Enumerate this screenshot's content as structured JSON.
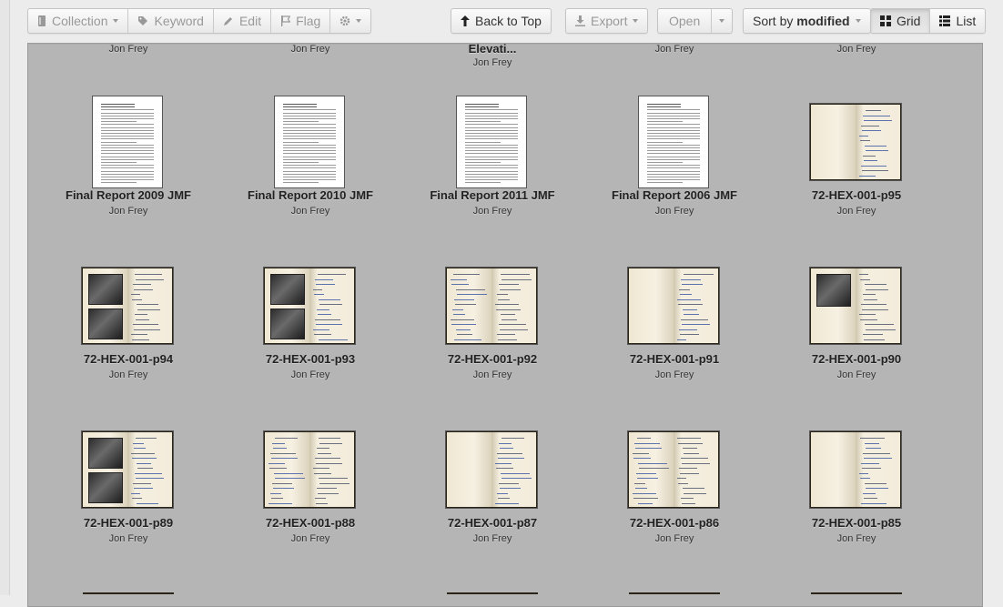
{
  "toolbar": {
    "collection": "Collection",
    "keyword": "Keyword",
    "edit": "Edit",
    "flag": "Flag",
    "back_to_top": "Back to Top",
    "export": "Export",
    "open": "Open",
    "sort_prefix": "Sort by",
    "sort_value": "modified",
    "grid": "Grid",
    "list": "List"
  },
  "top_row": [
    {
      "title": "",
      "author": "Jon Frey"
    },
    {
      "title": "",
      "author": "Jon Frey"
    },
    {
      "title": "Elevati...",
      "author": "Jon Frey"
    },
    {
      "title": "",
      "author": "Jon Frey"
    },
    {
      "title": "",
      "author": "Jon Frey"
    }
  ],
  "rows": [
    [
      {
        "kind": "doc",
        "title": "Final Report 2009 JMF",
        "author": "Jon Frey"
      },
      {
        "kind": "doc",
        "title": "Final Report 2010 JMF",
        "author": "Jon Frey"
      },
      {
        "kind": "doc",
        "title": "Final Report 2011 JMF",
        "author": "Jon Frey"
      },
      {
        "kind": "doc",
        "title": "Final Report 2006 JMF",
        "author": "Jon Frey"
      },
      {
        "kind": "book",
        "photos": 0,
        "title": "72-HEX-001-p95",
        "author": "Jon Frey"
      }
    ],
    [
      {
        "kind": "book",
        "photos": 2,
        "title": "72-HEX-001-p94",
        "author": "Jon Frey"
      },
      {
        "kind": "book",
        "photos": 2,
        "title": "72-HEX-001-p93",
        "author": "Jon Frey"
      },
      {
        "kind": "book",
        "photos": 0,
        "title": "72-HEX-001-p92",
        "author": "Jon Frey"
      },
      {
        "kind": "book",
        "photos": 0,
        "title": "72-HEX-001-p91",
        "author": "Jon Frey"
      },
      {
        "kind": "book",
        "photos": 1,
        "title": "72-HEX-001-p90",
        "author": "Jon Frey"
      }
    ],
    [
      {
        "kind": "book",
        "photos": 2,
        "title": "72-HEX-001-p89",
        "author": "Jon Frey"
      },
      {
        "kind": "book",
        "photos": 0,
        "title": "72-HEX-001-p88",
        "author": "Jon Frey"
      },
      {
        "kind": "book",
        "photos": 0,
        "title": "72-HEX-001-p87",
        "author": "Jon Frey"
      },
      {
        "kind": "book",
        "photos": 0,
        "title": "72-HEX-001-p86",
        "author": "Jon Frey"
      },
      {
        "kind": "book",
        "photos": 0,
        "title": "72-HEX-001-p85",
        "author": "Jon Frey"
      }
    ]
  ]
}
